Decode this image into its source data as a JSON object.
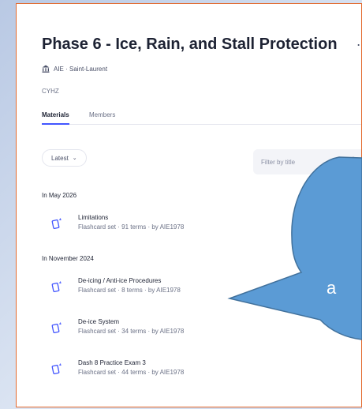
{
  "header": {
    "title": "Phase 6 - Ice, Rain, and Stall Protection",
    "more_label": "··",
    "org": "AIE · Saint-Laurent",
    "code": "CYHZ"
  },
  "tabs": [
    {
      "label": "Materials",
      "active": true
    },
    {
      "label": "Members",
      "active": false
    }
  ],
  "toolbar": {
    "sort_label": "Latest",
    "filter_placeholder": "Filter by title"
  },
  "groups": [
    {
      "title": "In May 2026",
      "items": [
        {
          "name": "Limitations",
          "meta": "Flashcard set  ·  91 terms  ·  by AIE1978"
        }
      ]
    },
    {
      "title": "In November 2024",
      "items": [
        {
          "name": "De-icing / Anti-ice Procedures",
          "meta": "Flashcard set  ·  8 terms  ·  by AIE1978"
        },
        {
          "name": "De-ice System",
          "meta": "Flashcard set  ·  34 terms  ·  by AIE1978"
        },
        {
          "name": "Dash 8 Practice Exam 3",
          "meta": "Flashcard set  ·  44 terms  ·  by AIE1978"
        }
      ]
    }
  ],
  "callout": {
    "text": "a",
    "fill": "#5b9bd5",
    "stroke": "#41719c"
  },
  "colors": {
    "accent": "#4255ff",
    "frame": "#e36a2e"
  }
}
